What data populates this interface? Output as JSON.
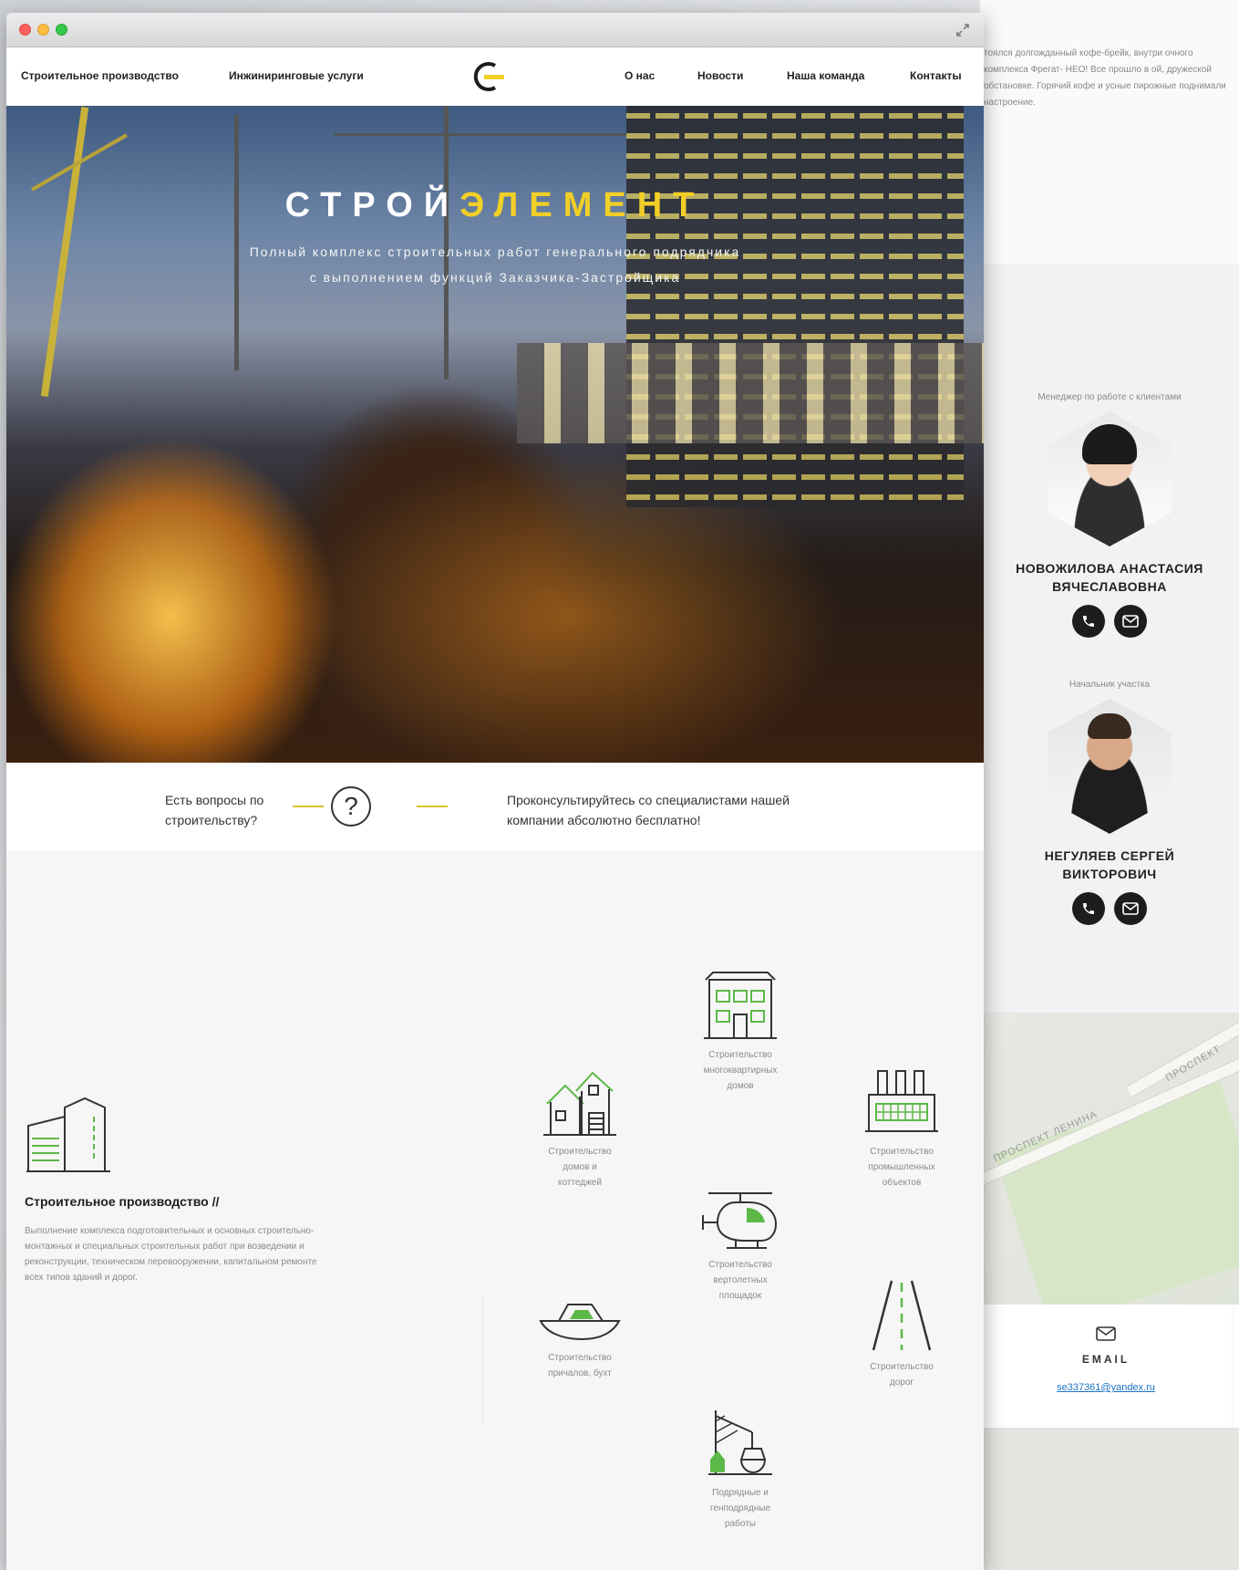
{
  "window": {
    "title_controls": [
      "close",
      "minimize",
      "zoom"
    ],
    "expand_icon": "expand-icon"
  },
  "nav": {
    "left_items": [
      "Строительное производство",
      "Инжиниринговые услуги"
    ],
    "right_items": [
      "О нас",
      "Новости",
      "Наша команда",
      "Контакты"
    ],
    "logo_icon": "logo-icon"
  },
  "hero": {
    "title_white": "СТРОЙ",
    "title_yellow": "ЭЛЕМЕНТ",
    "subtitle_line1": "Полный комплекс строительных работ генерального подрядчика",
    "subtitle_line2": "с выполнением функций Заказчика-Застройщика"
  },
  "consult": {
    "question_line1": "Есть вопросы по",
    "question_line2": "строительству?",
    "question_mark": "?",
    "answer_line1": "Проконсультируйтесь со специалистами нашей",
    "answer_line2": "компании абсолютно бесплатно!"
  },
  "services": {
    "heading": "Строительное производство //",
    "description": "Выполнение комплекса подготовительных и основных строительно-монтажных и специальных строительных работ при возведении и реконструкции, техническом перевооружении, капитальном ремонте всех типов зданий и дорог.",
    "items": [
      {
        "label1": "Строительство",
        "label2": "многоквартирных",
        "label3": "домов",
        "icon": "apartment-building-icon"
      },
      {
        "label1": "Строительство",
        "label2": "домов и",
        "label3": "коттеджей",
        "icon": "cottage-icon"
      },
      {
        "label1": "Строительство",
        "label2": "промышленных",
        "label3": "объектов",
        "icon": "factory-icon"
      },
      {
        "label1": "Строительство",
        "label2": "вертолетных",
        "label3": "площадок",
        "icon": "helicopter-icon"
      },
      {
        "label1": "Строительство",
        "label2": "причалов, бухт",
        "label3": "",
        "icon": "boat-icon"
      },
      {
        "label1": "Строительство",
        "label2": "дорог",
        "label3": "",
        "icon": "road-icon"
      },
      {
        "label1": "Подрядные и",
        "label2": "генподрядные",
        "label3": "работы",
        "icon": "crane-icon"
      }
    ]
  },
  "bg_page": {
    "news_text": "тоялся долгожданный кофе-брейк, внутри очного комплекса Фрегат- НЕО! Все прошло в ой, дружеской обстановке. Горячий кофе и усные пирожные поднимали настроение.",
    "team": [
      {
        "role": "Менеджер по работе с клиентами",
        "name_line1": "НОВОЖИЛОВА АНАСТАСИЯ",
        "name_line2": "ВЯЧЕСЛАВОВНА"
      },
      {
        "role": "Начальник участка",
        "name_line1": "НЕГУЛЯЕВ СЕРГЕЙ",
        "name_line2": "ВИКТОРОВИЧ"
      }
    ],
    "map_labels": [
      "ПРОСПЕКТ ЛЕНИНА",
      "ПРОСПЕКТ"
    ],
    "email_label": "EMAIL",
    "email_value": "se337361@yandex.ru"
  },
  "colors": {
    "accent_yellow": "#f2cf26",
    "accent_green": "#5cb947",
    "dark": "#1d1d1d"
  }
}
